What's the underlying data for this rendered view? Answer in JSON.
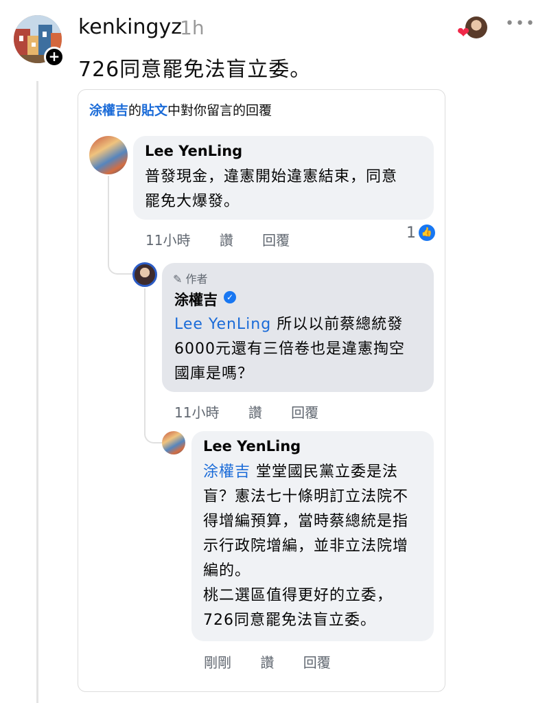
{
  "post": {
    "username": "kenkingyz",
    "time": "1h",
    "text": "726同意罷免法盲立委。",
    "follow_symbol": "+",
    "more_symbol": "•••",
    "reaction_symbol": "❤"
  },
  "card": {
    "header_author": "涂權吉",
    "header_mid": "的",
    "header_link": "貼文",
    "header_tail": "中對你留言的回覆"
  },
  "comments": [
    {
      "name": "Lee YenLing",
      "lines": [
        "普發現金，違憲開始違憲結束，同意",
        "罷免大爆發。"
      ],
      "time": "11小時",
      "like": "讚",
      "reply": "回覆",
      "like_count": "1"
    },
    {
      "tag": "作者",
      "name": "涂權吉",
      "mention": "Lee YenLing",
      "line1_rest": " 所以以前蔡總統發",
      "lines": [
        "6000元還有三倍卷也是違憲掏空",
        "國庫是嗎？"
      ],
      "time": "11小時",
      "like": "讚",
      "reply": "回覆"
    },
    {
      "name": "Lee YenLing",
      "mention": "涂權吉",
      "line1_rest": " 堂堂國民黨立委是法",
      "lines": [
        "盲？憲法七十條明訂立法院不",
        "得增編預算，當時蔡總統是指",
        "示行政院增編，並非立法院增",
        "編的。",
        "桃二選區值得更好的立委，",
        "726同意罷免法盲立委。"
      ],
      "time": "剛剛",
      "like": "讚",
      "reply": "回覆"
    }
  ],
  "colors": {
    "link": "#1a6bd8",
    "verified": "#1877f2",
    "heart": "#f02849"
  }
}
